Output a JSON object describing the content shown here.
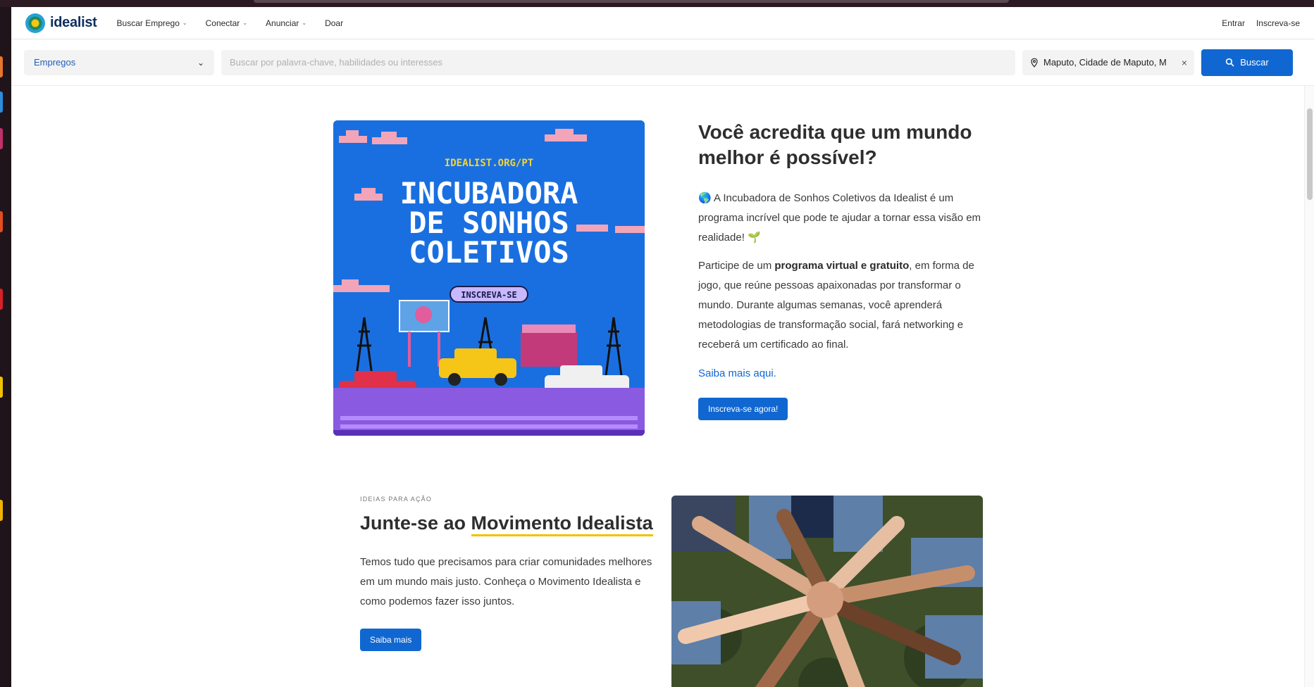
{
  "nav": {
    "logo": "idealist",
    "items": [
      {
        "label": "Buscar Emprego",
        "dropdown": true
      },
      {
        "label": "Conectar",
        "dropdown": true
      },
      {
        "label": "Anunciar",
        "dropdown": true
      },
      {
        "label": "Doar",
        "dropdown": false
      }
    ],
    "login": "Entrar",
    "signup": "Inscreva-se"
  },
  "search": {
    "category": "Empregos",
    "placeholder": "Buscar por palavra-chave, habilidades ou interesses",
    "location": "Maputo, Cidade de Maputo, M",
    "button": "Buscar"
  },
  "section1": {
    "image_texts": {
      "url": "IDEALIST.ORG/PT",
      "line1": "INCUBADORA",
      "line2": "DE SONHOS",
      "line3": "COLETIVOS",
      "badge": "INSCREVA-SE"
    },
    "title": "Você acredita que um mundo melhor é possível?",
    "p1_emoji": "🌎",
    "p1": "A Incubadora de Sonhos Coletivos da Idealist é um programa incrível que pode te ajudar a tornar essa visão em realidade!",
    "p1_end_emoji": "🌱",
    "p2_pre": "Participe de um ",
    "p2_bold": "programa virtual e gratuito",
    "p2_post": ", em forma de jogo, que reúne pessoas apaixonadas por transformar o mundo. Durante algumas semanas, você aprenderá metodologias de transformação social, fará networking e receberá um certificado ao final.",
    "link": "Saiba mais aqui.",
    "cta": "Inscreva-se agora!"
  },
  "section2": {
    "eyebrow": "IDEIAS PARA AÇÃO",
    "title_pre": "Junte-se ao ",
    "title_highlight": "Movimento Idealista",
    "body": "Temos tudo que precisamos para criar comunidades melhores em um mundo mais justo. Conheça o Movimento Idealista e como podemos fazer isso juntos.",
    "cta": "Saiba mais"
  },
  "colors": {
    "brand_blue": "#1067d1",
    "highlight_yellow": "#f2c200"
  }
}
